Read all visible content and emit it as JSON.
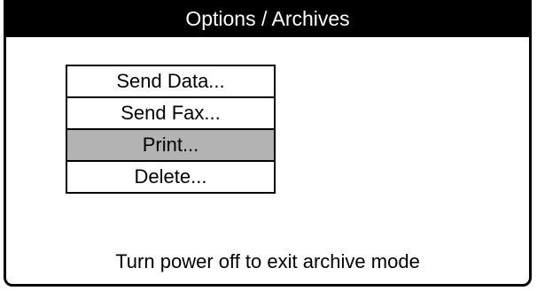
{
  "window": {
    "title": "Options / Archives"
  },
  "menu": {
    "items": [
      {
        "label": "Send Data...",
        "selected": false
      },
      {
        "label": "Send Fax...",
        "selected": false
      },
      {
        "label": "Print...",
        "selected": true
      },
      {
        "label": "Delete...",
        "selected": false
      }
    ]
  },
  "status": {
    "message": "Turn power off to exit archive mode"
  },
  "colors": {
    "title_bar_bg": "#000000",
    "title_bar_fg": "#ffffff",
    "selection_bg": "#b3b3b3"
  }
}
